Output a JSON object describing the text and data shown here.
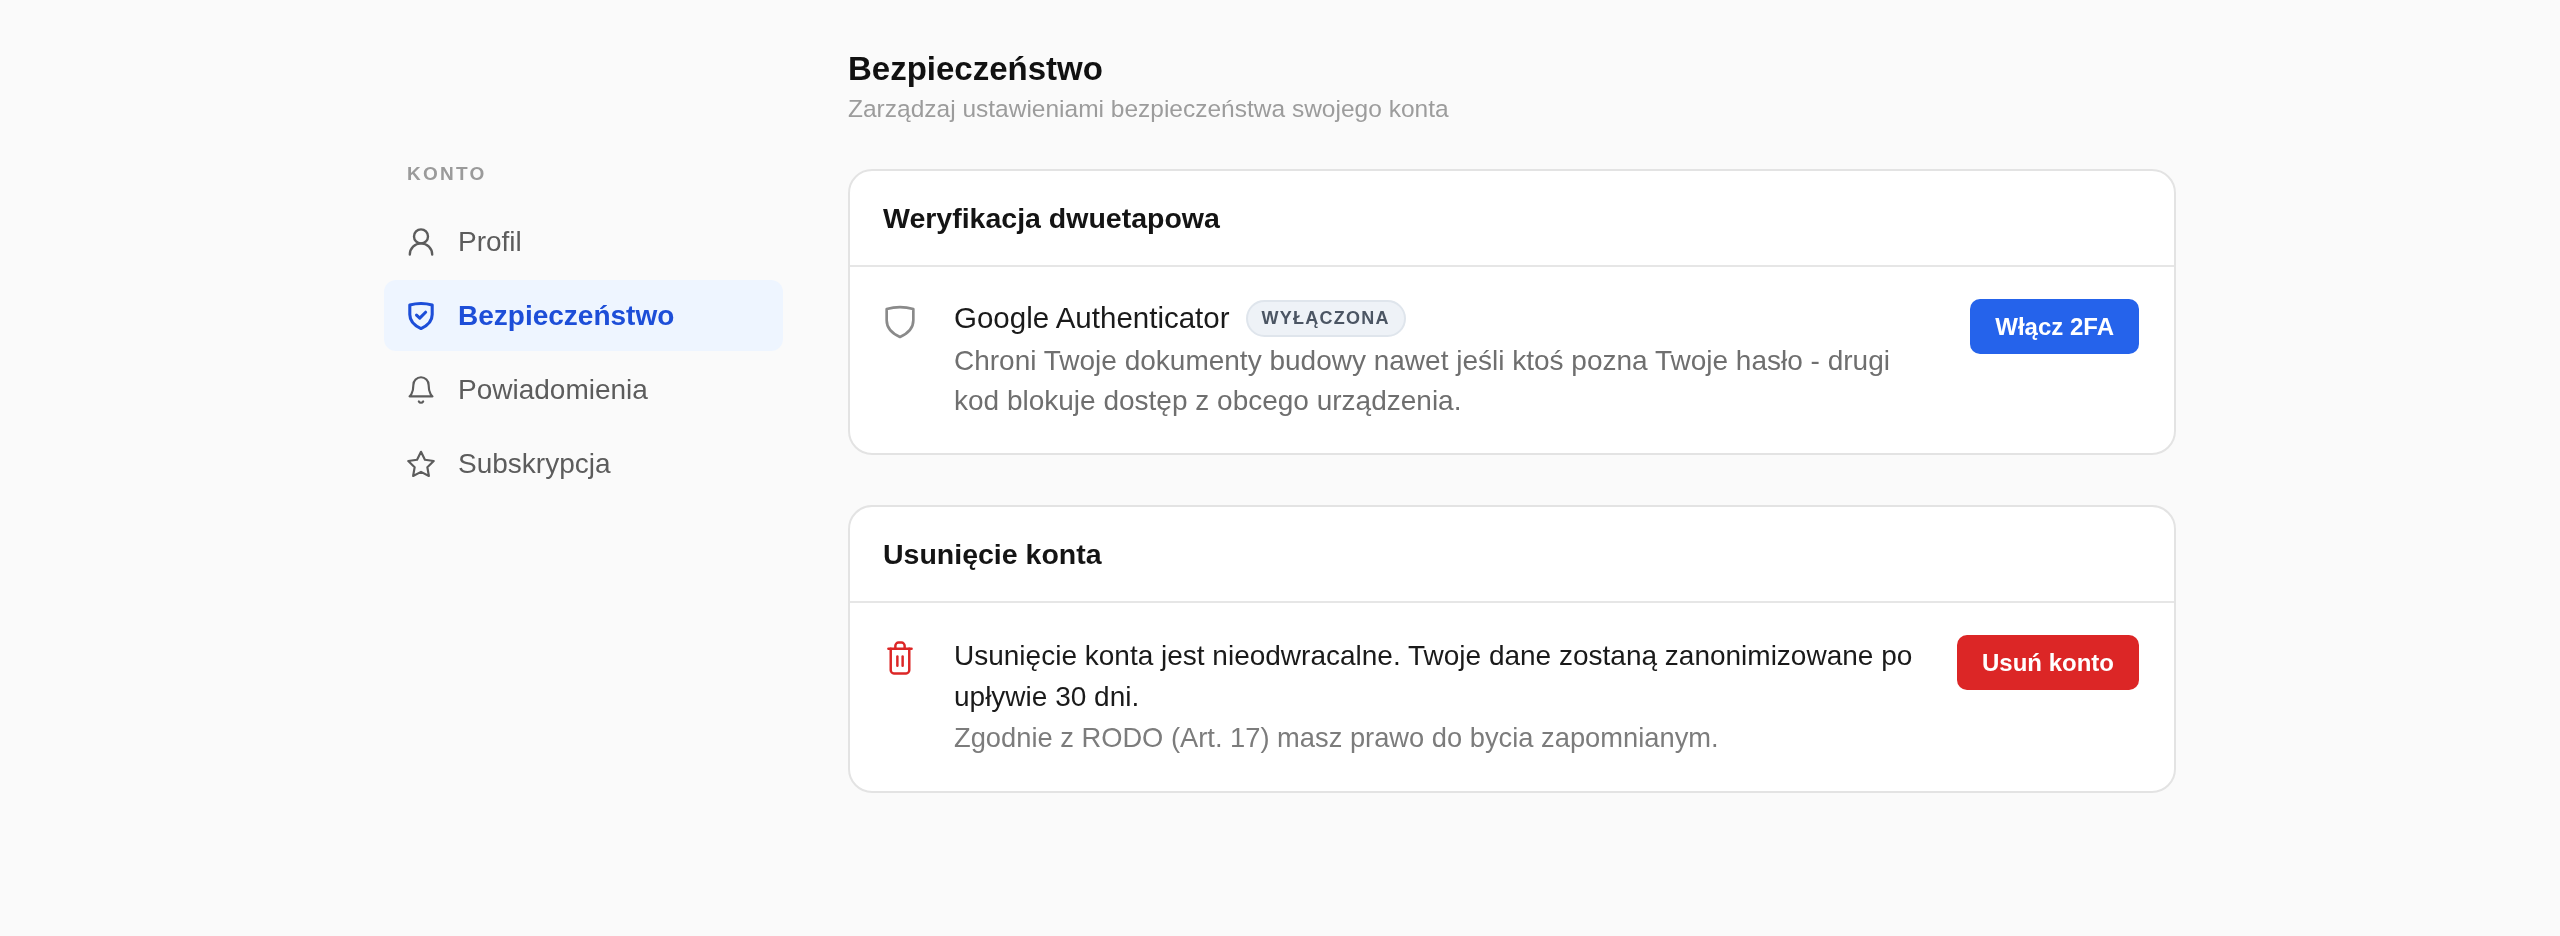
{
  "page": {
    "title": "Bezpieczeństwo",
    "subtitle": "Zarządzaj ustawieniami bezpieczeństwa swojego konta"
  },
  "sidebar": {
    "heading": "KONTO",
    "items": [
      {
        "label": "Profil",
        "selected": false
      },
      {
        "label": "Bezpieczeństwo",
        "selected": true
      },
      {
        "label": "Powiadomienia",
        "selected": false
      },
      {
        "label": "Subskrypcja",
        "selected": false
      }
    ]
  },
  "cards": [
    {
      "kind": "two_factor",
      "title": "Weryfikacja dwuetapowa",
      "name": "Google Authenticator",
      "status": "WYŁĄCZONA",
      "description": "Chroni Twoje dokumenty budowy nawet jeśli ktoś pozna Twoje hasło - drugi kod blokuje dostęp z obcego urządzenia.",
      "button": "Włącz 2FA"
    },
    {
      "kind": "delete_account",
      "title": "Usunięcie konta",
      "warning": "Usunięcie konta jest nieodwracalne. Twoje dane zostaną zanonimizowane po upływie 30 dni.",
      "note": "Zgodnie z RODO (Art. 17) masz prawo do bycia zapomnianym.",
      "button": "Usuń konto"
    }
  ]
}
